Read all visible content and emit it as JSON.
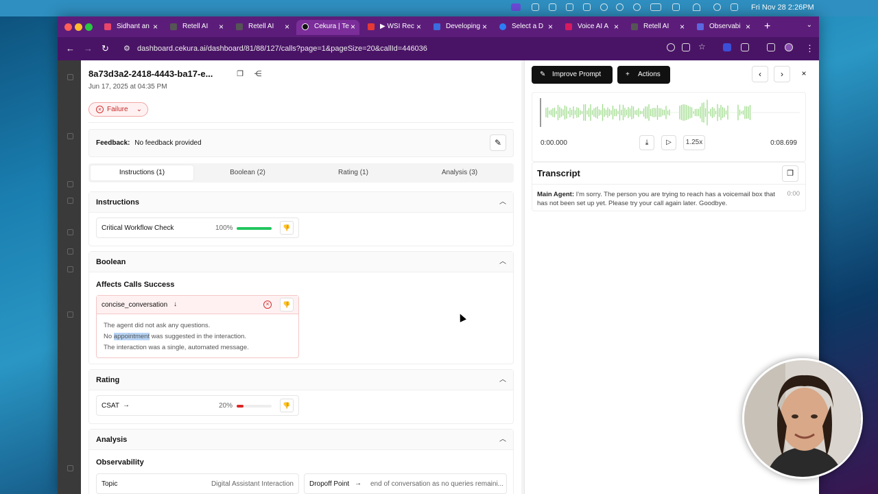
{
  "menubar": {
    "clock": "Fri Nov 28  2:26PM"
  },
  "browser": {
    "tabs": [
      {
        "label": "Sidhant an",
        "color": "#e9446a"
      },
      {
        "label": "Retell AI",
        "color": "#333"
      },
      {
        "label": "Retell AI",
        "color": "#333"
      },
      {
        "label": "Cekura | Te",
        "color": "#111"
      },
      {
        "label": "▶ WSI Rec",
        "color": "#e53935"
      },
      {
        "label": "Developing",
        "color": "#3b6ce0"
      },
      {
        "label": "Select a D",
        "color": "#2d7df6"
      },
      {
        "label": "Voice AI A",
        "color": "#d81b60"
      },
      {
        "label": "Retell AI",
        "color": "#333"
      },
      {
        "label": "Observabi",
        "color": "#5b67e0"
      }
    ],
    "url": "dashboard.cekura.ai/dashboard/81/88/127/calls?page=1&pageSize=20&callId=446036"
  },
  "call": {
    "title": "8a73d3a2-2418-4443-ba17-e...",
    "date": "Jun 17, 2025 at 04:35 PM",
    "status": "Failure",
    "feedback_label": "Feedback:",
    "feedback_value": "No feedback provided"
  },
  "tabs": [
    "Instructions (1)",
    "Boolean (2)",
    "Rating (1)",
    "Analysis (3)"
  ],
  "instructions": {
    "heading": "Instructions",
    "metric": "Critical Workflow Check",
    "percent_label": "100%",
    "progress": 1.0
  },
  "boolean": {
    "heading": "Boolean",
    "subheading": "Affects Calls Success",
    "metric": "concise_conversation",
    "reason_1": "The agent did not ask any questions.",
    "reason_2a": "No ",
    "reason_2b": "appointment",
    "reason_2c": " was suggested in the interaction.",
    "reason_3": "The interaction was a single, automated message."
  },
  "rating": {
    "heading": "Rating",
    "metric": "CSAT",
    "percent_label": "20%",
    "progress": 0.2
  },
  "analysis": {
    "heading": "Analysis",
    "subheading": "Observability",
    "topic_label": "Topic",
    "topic_value": "Digital Assistant Interaction",
    "dropoff_label": "Dropoff Point",
    "dropoff_value": "end of conversation as no queries remaini..."
  },
  "right": {
    "improve_label": "Improve Prompt",
    "actions_label": "Actions",
    "time_start": "0:00.000",
    "time_end": "0:08.699",
    "speed": "1.25x",
    "transcript_title": "Transcript",
    "speaker": "Main Agent:",
    "message": "I'm sorry. The person you are trying to reach has a voicemail box that has not been set up yet. Please try your call again later. Goodbye.",
    "timestamp": "0:00"
  },
  "colors": {
    "success": "#22c55e",
    "danger": "#dc2626",
    "wave": "#9fdc8c"
  }
}
